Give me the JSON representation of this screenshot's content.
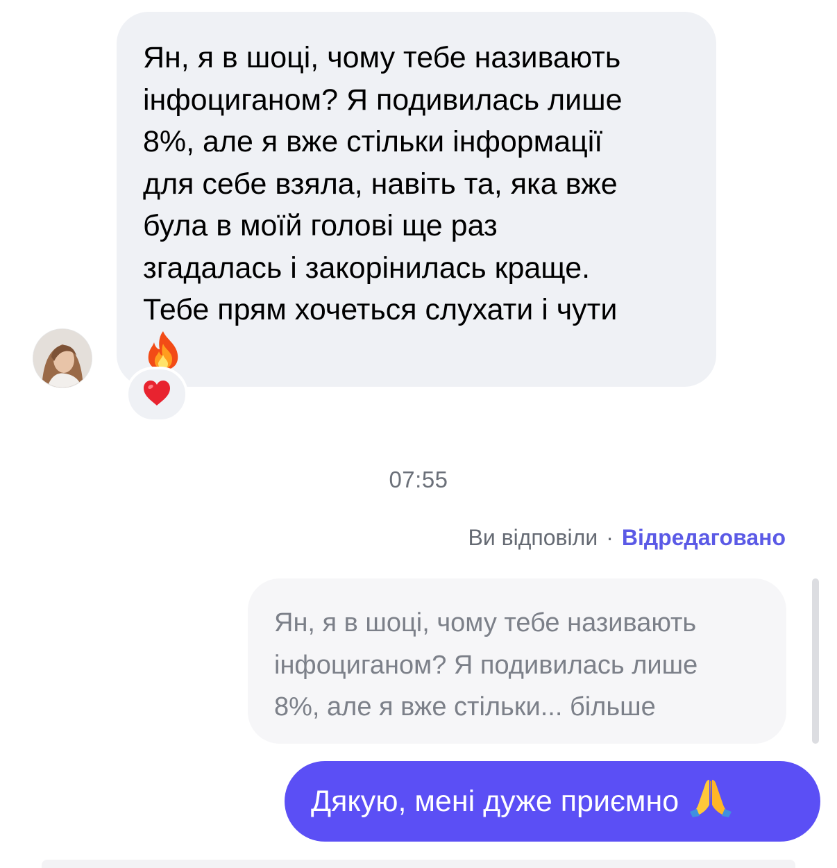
{
  "incoming_message": {
    "text": "Ян, я в шоці, чому тебе називають\nінфоциганом? Я подивилась лише\n8%, але я вже стільки інформації\nдля себе взяла, навіть та, яка вже\nбула в моїй голові ще раз\nзгадалась і закорінилась краще.\nТебе прям хочеться слухати і чути",
    "emoji_icon": "fire-icon",
    "reaction_icon": "red-heart-icon"
  },
  "timestamp": "07:55",
  "reply_header": {
    "replied_label": "Ви відповіли",
    "separator": "·",
    "edited_label": "Відредаговано"
  },
  "quoted_message": {
    "text": "Ян, я в шоці, чому тебе називають\nінфоциганом? Я подивилась лише\n8%, але я вже стільки... більше"
  },
  "outgoing_message": {
    "text": "Дякую, мені дуже приємно",
    "emoji_icon": "folded-hands-icon"
  },
  "colors": {
    "incoming_bubble": "#eff1f5",
    "outgoing_bubble": "#5b4ff5",
    "accent_link": "#5b5ae6",
    "meta_text": "#656a73"
  }
}
